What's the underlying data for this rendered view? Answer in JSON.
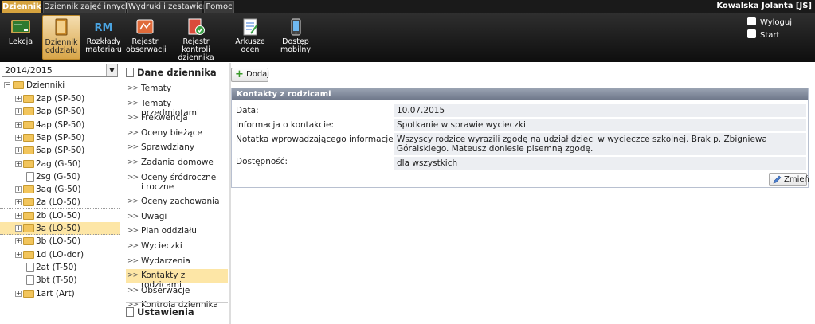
{
  "menu": {
    "tabs": [
      {
        "label": "Dziennik",
        "active": true
      },
      {
        "label": "Dziennik zajęć innych",
        "active": false
      },
      {
        "label": "Wydruki i zestawienia",
        "active": false
      },
      {
        "label": "Pomoc",
        "active": false
      }
    ],
    "user": "Kowalska Jolanta [JS]"
  },
  "toolbar": {
    "buttons": [
      {
        "label": "Lekcja",
        "icon": "lesson-icon"
      },
      {
        "label": "Dziennik\noddziału",
        "icon": "journal-icon",
        "active": true
      },
      {
        "label": "Rozkłady\nmateriału",
        "icon": "rm-icon",
        "icon_text": "RM"
      },
      {
        "label": "Rejestr\nobserwacji",
        "icon": "observation-icon"
      },
      {
        "label": "Rejestr kontroli\ndziennika",
        "icon": "control-register-icon"
      },
      {
        "label": "Arkusze\nocen",
        "icon": "grade-sheet-icon"
      },
      {
        "label": "Dostęp\nmobilny",
        "icon": "mobile-icon"
      }
    ],
    "logout": "Wyloguj",
    "start": "Start"
  },
  "tree": {
    "year": "2014/2015",
    "root": "Dzienniki",
    "items": [
      {
        "label": "2ap (SP-50)",
        "expandable": true
      },
      {
        "label": "3ap (SP-50)",
        "expandable": true
      },
      {
        "label": "4ap (SP-50)",
        "expandable": true
      },
      {
        "label": "5ap (SP-50)",
        "expandable": true
      },
      {
        "label": "6ap (SP-50)",
        "expandable": true
      },
      {
        "label": "2ag (G-50)",
        "expandable": true
      },
      {
        "label": "2sg (G-50)",
        "expandable": false
      },
      {
        "label": "3ag (G-50)",
        "expandable": true
      },
      {
        "label": "2a (LO-50)",
        "expandable": true
      },
      {
        "label": "2b (LO-50)",
        "expandable": true
      },
      {
        "label": "3a (LO-50)",
        "expandable": true,
        "selected": true
      },
      {
        "label": "3b (LO-50)",
        "expandable": true
      },
      {
        "label": "1d (LO-dor)",
        "expandable": true
      },
      {
        "label": "2at (T-50)",
        "expandable": false
      },
      {
        "label": "3bt (T-50)",
        "expandable": false
      },
      {
        "label": "1art (Art)",
        "expandable": true
      }
    ]
  },
  "sidebar": {
    "header": "Dane dziennika",
    "items": [
      "Tematy",
      "Tematy przedmiotami",
      "Frekwencja",
      "Oceny bieżące",
      "Sprawdziany",
      "Zadania domowe",
      "Oceny śródroczne\ni roczne",
      "Oceny zachowania",
      "Uwagi",
      "Plan oddziału",
      "Wycieczki",
      "Wydarzenia",
      "Kontakty z rodzicami",
      "Obserwacje",
      "Kontrola dziennika"
    ],
    "selected": "Kontakty z rodzicami",
    "footer": "Ustawienia dziennika"
  },
  "main": {
    "add_label": "Dodaj",
    "panel_title": "Kontakty z rodzicami",
    "fields": [
      {
        "label": "Data:",
        "value": "10.07.2015"
      },
      {
        "label": "Informacja o kontakcie:",
        "value": "Spotkanie w sprawie wycieczki"
      },
      {
        "label": "Notatka wprowadzającego informacje:",
        "value": "Wszyscy rodzice wyrazili zgodę na udział dzieci w wycieczce szkolnej. Brak p. Zbigniewa Góralskiego. Mateusz doniesie pisemną zgodę."
      },
      {
        "label": "Dostępność:",
        "value": "dla wszystkich"
      }
    ],
    "edit_label": "Zmień"
  },
  "colors": {
    "accent": "#d6a33e",
    "selected_bg": "#fde6a6",
    "panel_header": "#7a8396"
  }
}
